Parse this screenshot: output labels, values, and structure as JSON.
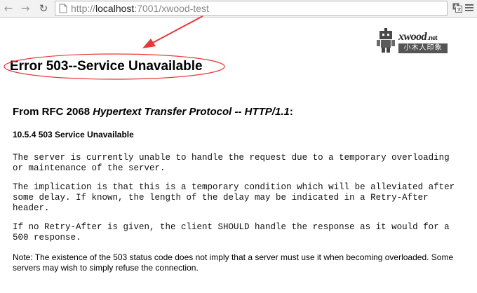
{
  "browser": {
    "url_prefix": "http://",
    "url_host": "localhost",
    "url_rest": ":7001/xwood-test"
  },
  "logo": {
    "brand": "xwood",
    "tld": ".net",
    "tagline": "小木人印象"
  },
  "page": {
    "title": "Error 503--Service Unavailable",
    "rfc_prefix": "From RFC 2068 ",
    "rfc_italic": "Hypertext Transfer Protocol -- HTTP/1.1",
    "rfc_suffix": ":",
    "section": "10.5.4 503 Service Unavailable",
    "para1": "The server is currently unable to handle the request due to a temporary overloading\nor maintenance of the server.",
    "para2": "The implication is that this is a temporary condition which will be alleviated after\nsome delay. If known, the length of the delay may be indicated in a Retry-After\nheader.",
    "para3": "If no Retry-After is given, the client SHOULD handle the response as it would for a\n500 response.",
    "note": "Note: The existence of the 503 status code does not imply that a server must use it when becoming overloaded. Some servers may wish to simply refuse the connection."
  },
  "annotation": {
    "color": "#e8373a"
  }
}
